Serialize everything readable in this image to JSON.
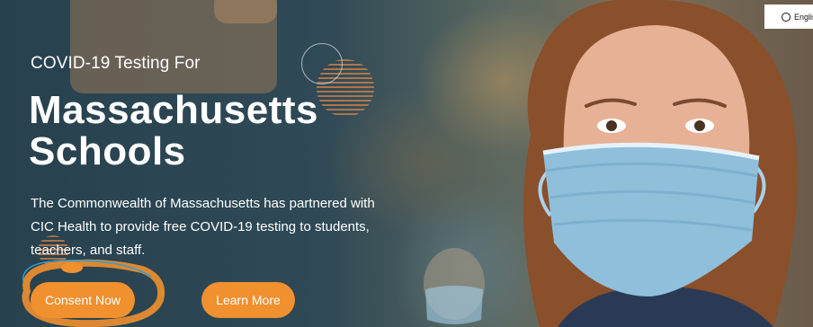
{
  "hero": {
    "subtitle": "COVID-19 Testing For",
    "title_line1": "Massachusetts",
    "title_line2": "Schools",
    "description": "The Commonwealth of Massachusetts has partnered with CIC Health to provide free COVID-19 testing to students, teachers, and staff."
  },
  "buttons": {
    "consent_label": "Consent Now",
    "learn_more_label": "Learn More"
  },
  "language": {
    "label": "Englis"
  },
  "colors": {
    "accent": "#f0902f",
    "background": "#2d4552",
    "text": "#ffffff",
    "mask": "#8fbfdb"
  },
  "icons": {
    "language_radio": "radio-icon"
  }
}
